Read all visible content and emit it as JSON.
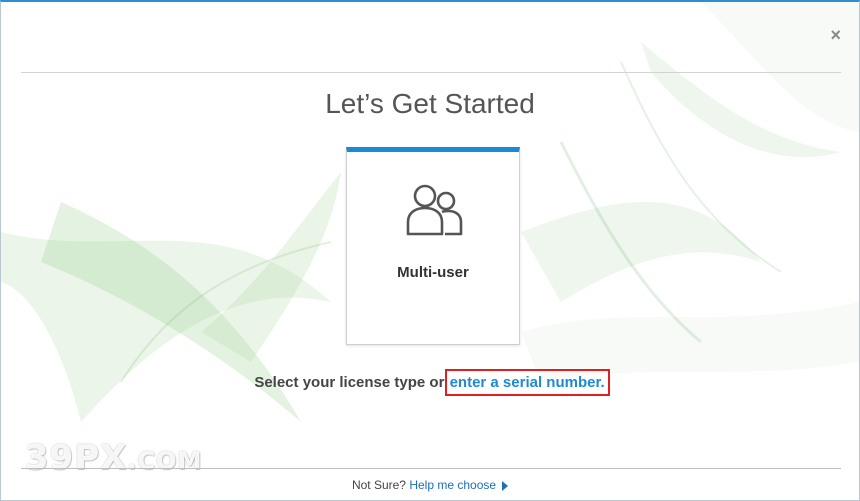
{
  "dialog": {
    "close_symbol": "×",
    "title": "Let’s Get Started"
  },
  "card": {
    "label": "Multi-user",
    "icon": "users-icon",
    "accent_color": "#1a8ad4"
  },
  "prompt": {
    "text": "Select your license type or ",
    "link": "enter a serial number",
    "suffix": "."
  },
  "footer": {
    "question": "Not Sure?",
    "help_link": "Help me choose",
    "arrow_icon": "triangle-right-icon"
  },
  "watermark": {
    "main": "39PX",
    "suffix": ".COM"
  }
}
